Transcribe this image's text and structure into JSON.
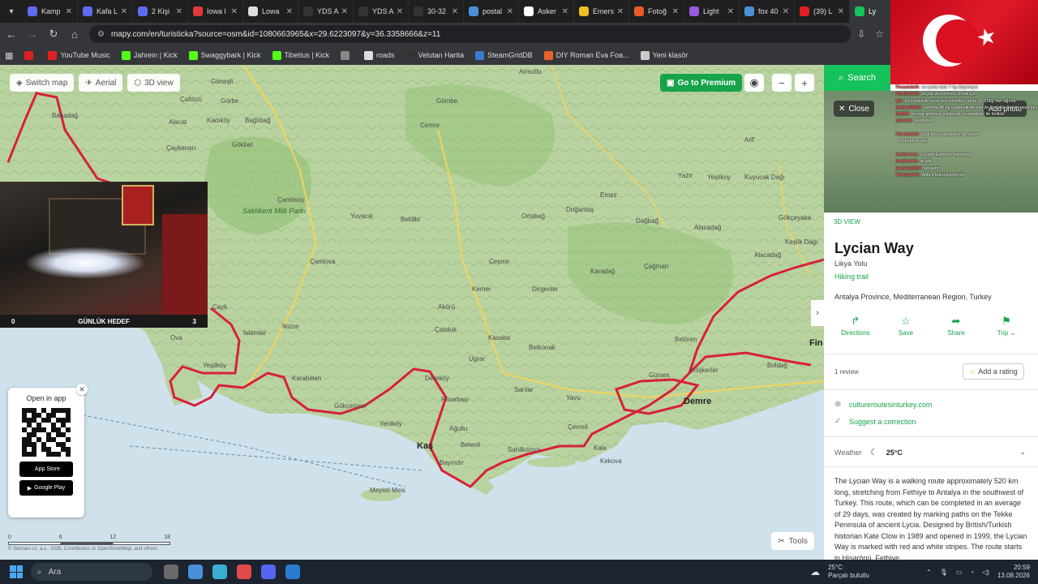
{
  "tabs": [
    {
      "label": "Kamp",
      "color": "#5b6cf0"
    },
    {
      "label": "Kafa L",
      "color": "#5b6cf0"
    },
    {
      "label": "2 Kişi",
      "color": "#5b6cf0"
    },
    {
      "label": "Iowa l",
      "color": "#e03a3a"
    },
    {
      "label": "Lowa",
      "color": "#dddddd"
    },
    {
      "label": "YDS A",
      "color": "#333333"
    },
    {
      "label": "YDS A",
      "color": "#333333"
    },
    {
      "label": "30-32",
      "color": "#333333"
    },
    {
      "label": "postal",
      "color": "#4a90d9"
    },
    {
      "label": "Asker",
      "color": "#ffffff"
    },
    {
      "label": "Emers",
      "color": "#e8c020"
    },
    {
      "label": "Fotoğ",
      "color": "#e85a2a"
    },
    {
      "label": "Light",
      "color": "#9a5ae0"
    },
    {
      "label": "fox 40",
      "color": "#4a90d9"
    },
    {
      "label": "(39) L",
      "color": "#e02020"
    },
    {
      "label": "Ly",
      "color": "#16c25b"
    }
  ],
  "address": {
    "url": "mapy.com/en/turisticka?source=osm&id=1080663965&x=29.6223097&y=36.3358666&z=11"
  },
  "bookmarks": [
    {
      "label": "",
      "color": "#e02020"
    },
    {
      "label": "YouTube Music",
      "color": "#e02020"
    },
    {
      "label": "Jahrein | Kick",
      "color": "#53fc18"
    },
    {
      "label": "Swaggybark | Kick",
      "color": "#53fc18"
    },
    {
      "label": "Tibetius | Kick",
      "color": "#53fc18"
    },
    {
      "label": "",
      "color": "#888888"
    },
    {
      "label": "roads",
      "color": "#dddddd"
    },
    {
      "label": "Velutan Harita",
      "color": "#333333"
    },
    {
      "label": "SteamGridDB",
      "color": "#3a7ad0"
    },
    {
      "label": "DIY Roman Eva Foa...",
      "color": "#e8602a"
    },
    {
      "label": "Yeni klasör",
      "color": "#cccccc"
    }
  ],
  "map": {
    "switch_map": "Switch map",
    "aerial": "Aerial",
    "view_3d": "3D view",
    "premium": "Go to Premium",
    "zoom_in": "+",
    "zoom_out": "−",
    "tools": "Tools",
    "scale_labels": [
      "0",
      "6",
      "12",
      "18"
    ],
    "attribution": "© Seznam.cz, a.s., 2026, Contributors to OpenStreetMap, and others",
    "labels": {
      "armutlu": "Armutlu",
      "gunesli": "Güneşli",
      "caltizuzu": "Çaltözü",
      "gorbe": "Görbe",
      "gombe": "Gömbe",
      "babadag": "Babadağ",
      "kadikoy": "Kadıköy",
      "baglibag": "Bağlıbağ",
      "cemre": "Cemre",
      "alacat": "Alacat",
      "caykenari": "Çaykenarı",
      "gokbel": "Gökbel",
      "arif": "Arif",
      "yazir": "Yazır",
      "yesilkoy": "Yeşilkoy",
      "kuyucak": "Kuyucak Dağı",
      "gokceyaka": "Gökçeyaka",
      "saklikent": "Saklıkent Milli Parkı",
      "camlikoy": "Çamlıköy",
      "yuvacik": "Yuvacık",
      "beldibi": "Beldibi",
      "ortabag": "Ortabağ",
      "doganta": "Doğantaş",
      "dagbag": "Dağbağ",
      "ernez": "Ernez",
      "alacadag": "Alacadağ",
      "kesliktag": "Keşlik Dağı",
      "camlova": "Çamlova",
      "cesme": "Çeşme",
      "kemer": "Kemer",
      "dirgenler": "Dirgenler",
      "karadag": "Karadağ",
      "cagman": "Çağman",
      "alacadag2": "Alacadağ",
      "akoru": "Akörü",
      "catoluk": "Çatoluk",
      "kasaba": "Kasaba",
      "ikizce": "İkizce",
      "islamlar": "İslamlar",
      "caykoy": "Çayk",
      "ugrar": "Ugrar",
      "belkonak": "Belkonak",
      "belören": "Belören",
      "kokler": "Köşkerler",
      "boldag": "Boldağ",
      "fin": "Fin",
      "yesilkoy2": "Yeşilköy",
      "ova": "Ova",
      "gokceoren": "Gökçeören",
      "dereköy": "Dereköy",
      "sarilar": "Sarılar",
      "yavu": "Yavu",
      "gursesi": "Gürses",
      "demre": "Demre",
      "pinarbasi": "Pınarbaşı",
      "agullu": "Ağullu",
      "yenikoy": "Yeniköy",
      "kas": "Kaş",
      "belenli": "Belenli",
      "cevreli": "Çevreli",
      "kaleuc": "Kale",
      "bayindir": "Bayındır",
      "sahilkilinc": "Sahilkılınçlı",
      "meis": "Meyisti Meis",
      "kekova": "Kekova",
      "karabelen": "Karabelen"
    }
  },
  "open_app": {
    "title": "Open in app",
    "app_store": "App Store",
    "google_play": "Google Play"
  },
  "stream": {
    "goal_left": "0",
    "goal_label": "GÜNLÜK HEDEF",
    "goal_right": "3"
  },
  "panel": {
    "search": "Search",
    "close": "Close",
    "add_photo": "Add photo",
    "view_3d": "3D VIEW",
    "title": "Lycian Way",
    "subtitle": "Likya Yolu",
    "type": "Hiking trail",
    "region": "Antalya Province, Mediterranean Region, Turkey",
    "actions": [
      {
        "label": "Directions",
        "icon": "directions-icon"
      },
      {
        "label": "Save",
        "icon": "star-icon"
      },
      {
        "label": "Share",
        "icon": "share-icon"
      },
      {
        "label": "Trip",
        "icon": "trip-icon"
      }
    ],
    "reviews": "1 review",
    "add_rating": "Add a rating",
    "website": "cultureroutesinturkey.com",
    "suggest": "Suggest a correction",
    "weather_label": "Weather",
    "weather_temp": "25°C",
    "description": "The Lycian Way is a walking route approximately 520 km long, stretching from Fethiye to Antalya in the southwest of Turkey. This route, which can be completed in an average of 29 days, was created by marking paths on the Tekke Peninsula of ancient Lycia. Designed by British/Turkish historian Kate Clow in 1989 and opened in 1999, the Lycian Way is marked with red and white stripes. The route starts in Hisarönü, Fethiye"
  },
  "chat": [
    {
      "user": "Thrashdeth",
      "msg": "ve çanta tabii 7 kg düşünüyor"
    },
    {
      "user": "Thrashdeth",
      "msg": "büyük ve konforlu olmak için"
    },
    {
      "user": "Adi",
      "msg": "bu çıkalarak kesin alın özellikle çanta 20-25kg dan ağırsa"
    },
    {
      "user": "kaafaa15000",
      "msg": "sırtında 40 kg çanta elinde mpt ile yürüsün bakım nasıl mutlu olur nasıl"
    },
    {
      "user": "MHDM",
      "msg": "muzlar görünce çekilecek muameleler ile birlikte"
    },
    {
      "user": "uploads",
      "msg": "eserlikler"
    },
    {
      "user": "",
      "msg": ""
    },
    {
      "user": "Thrashdeth",
      "msg": "Gey köyü varsa ben de varım"
    },
    {
      "user": "",
      "msg": "hoşbuldum dayı"
    },
    {
      "user": "",
      "msg": ""
    },
    {
      "user": "KoklerArts",
      "msg": "Google Earthten baksana"
    },
    {
      "user": "torpidoreis",
      "msg": "ai işte"
    },
    {
      "user": "kaafaa15000",
      "msg": "nevşehir"
    },
    {
      "user": "Thrashdeth",
      "msg": "Wtfa k bütünleşmeyen"
    }
  ],
  "taskbar": {
    "search": "Ara",
    "weather_temp": "25°C",
    "weather_desc": "Parçalı bulutlu",
    "time": "20:59",
    "date": "13.08.2026",
    "apps": [
      {
        "color": "#6a6a6a"
      },
      {
        "color": "#4a90d9"
      },
      {
        "color": "#3ab0d0"
      },
      {
        "color": "#e04a4a"
      },
      {
        "color": "#5865f2"
      },
      {
        "color": "#2a7ad0"
      }
    ]
  }
}
